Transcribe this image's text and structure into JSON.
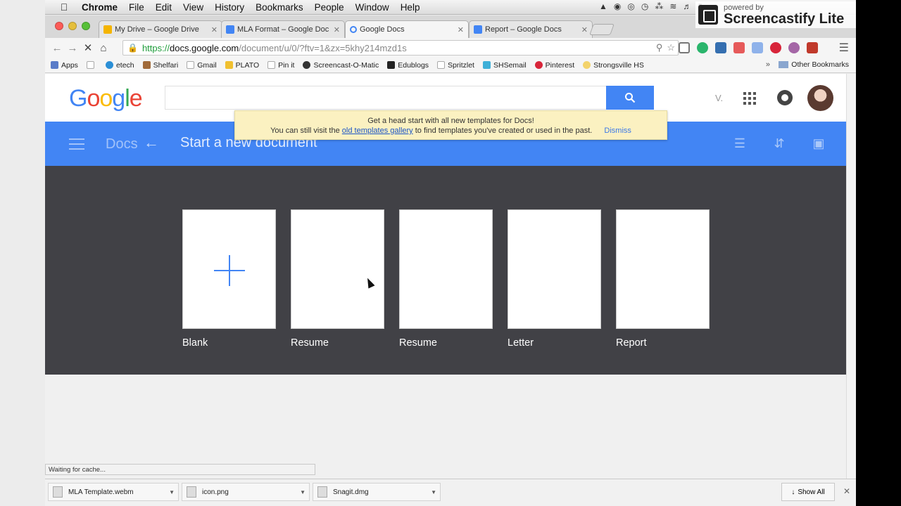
{
  "menubar": {
    "items": [
      "Chrome",
      "File",
      "Edit",
      "View",
      "History",
      "Bookmarks",
      "People",
      "Window",
      "Help"
    ]
  },
  "overlay": {
    "powered": "powered by",
    "name": "Screencastify Lite"
  },
  "tabs": [
    {
      "label": "My Drive – Google Drive",
      "color": "#f4b400"
    },
    {
      "label": "MLA Format – Google Doc",
      "color": "#4285f4"
    },
    {
      "label": "Google Docs",
      "color": "#4285f4"
    },
    {
      "label": "Report – Google Docs",
      "color": "#4285f4"
    }
  ],
  "toolbar": {
    "url_https": "https://",
    "url_host": "docs.google.com",
    "url_path": "/document/u/0/?ftv=1&zx=5khy214mzd1s"
  },
  "bookmarks": [
    "Apps",
    "etech",
    "Shelfari",
    "Gmail",
    "PLATO",
    "Pin it",
    "Screencast-O-Matic",
    "Edublogs",
    "Spritzlet",
    "SHSemail",
    "Pinterest",
    "Strongsville HS"
  ],
  "bookmarks_other": "Other Bookmarks",
  "header": {
    "logo": [
      "G",
      "o",
      "o",
      "g",
      "l",
      "e"
    ],
    "user_initial": "V."
  },
  "banner": {
    "line1": "Get a head start with all new templates for Docs!",
    "line2_pre": "You can still visit the",
    "line2_link": "old templates gallery",
    "line2_post": "to find templates you've created or used in the past.",
    "dismiss": "Dismiss"
  },
  "bluebar": {
    "docs": "Docs",
    "title": "Start a new document"
  },
  "templates": [
    {
      "label": "Blank"
    },
    {
      "label": "Resume"
    },
    {
      "label": "Resume"
    },
    {
      "label": "Letter"
    },
    {
      "label": "Report"
    }
  ],
  "status": "Waiting for cache...",
  "downloads": [
    {
      "name": "MLA Template.webm"
    },
    {
      "name": "icon.png"
    },
    {
      "name": "Snagit.dmg"
    }
  ],
  "show_all": "Show All",
  "colors": {
    "accent": "#4285f4",
    "template_bg": "#414146"
  }
}
